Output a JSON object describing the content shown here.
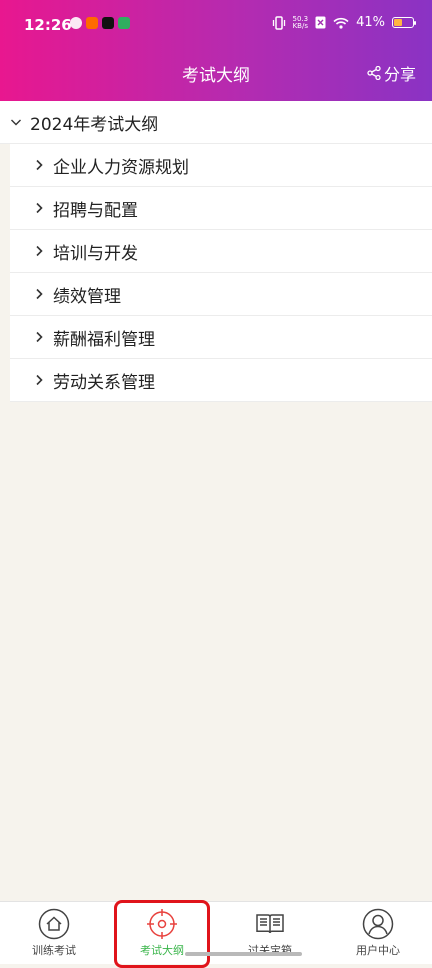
{
  "status_bar": {
    "time": "12:26",
    "net_speed_value": "50.3",
    "net_speed_unit": "KB/s",
    "battery": "41%",
    "battery_level": 0.41
  },
  "header": {
    "title": "考试大纲",
    "share_label": "分享"
  },
  "outline": {
    "group_label": "2024年考试大纲",
    "items": [
      {
        "label": "企业人力资源规划"
      },
      {
        "label": "招聘与配置"
      },
      {
        "label": "培训与开发"
      },
      {
        "label": "绩效管理"
      },
      {
        "label": "薪酬福利管理"
      },
      {
        "label": "劳动关系管理"
      }
    ]
  },
  "tabbar": {
    "tabs": [
      {
        "label": "训练考试",
        "icon": "home-icon"
      },
      {
        "label": "考试大纲",
        "icon": "crosshair-icon"
      },
      {
        "label": "过关宝箱",
        "icon": "book-icon"
      },
      {
        "label": "用户中心",
        "icon": "user-icon"
      }
    ],
    "active_color": "#39b54a"
  }
}
